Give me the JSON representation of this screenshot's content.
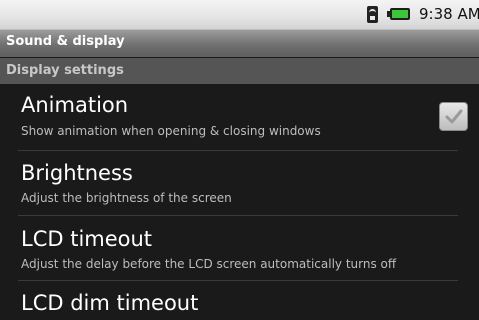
{
  "status_bar": {
    "time": "9:38 AM",
    "icons": [
      "signal-icon",
      "battery-icon"
    ],
    "battery_color": "#3bc63b"
  },
  "title_bar": {
    "title": "Sound & display"
  },
  "category": {
    "label": "Display settings"
  },
  "preferences": [
    {
      "title": "Animation",
      "summary": "Show animation when opening & closing windows",
      "checkbox": {
        "checked": true
      }
    },
    {
      "title": "Brightness",
      "summary": "Adjust the brightness of the screen"
    },
    {
      "title": "LCD timeout",
      "summary": "Adjust the delay before the LCD screen automatically turns off"
    },
    {
      "title": "LCD dim timeout",
      "summary": ""
    }
  ]
}
